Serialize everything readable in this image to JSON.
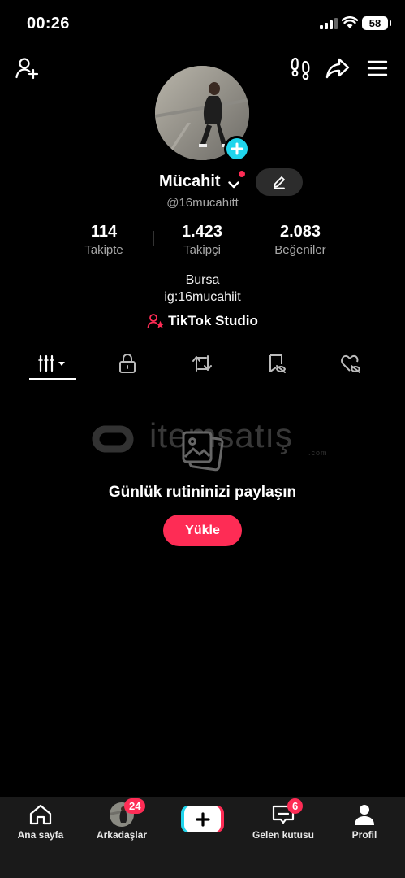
{
  "status_bar": {
    "time": "00:26",
    "battery": "58"
  },
  "profile": {
    "name": "Mücahit",
    "handle": "@16mucahitt",
    "stats": [
      {
        "value": "114",
        "label": "Takipte"
      },
      {
        "value": "1.423",
        "label": "Takipçi"
      },
      {
        "value": "2.083",
        "label": "Beğeniler"
      }
    ],
    "bio_line1": "Bursa",
    "bio_line2": "ig:16mucahiit",
    "studio_label": "TikTok Studio"
  },
  "watermark": {
    "brand": "itemsatış",
    "domain": ".com"
  },
  "empty_state": {
    "title": "Günlük rutininizi paylaşın",
    "button": "Yükle"
  },
  "bottom_nav": {
    "home": "Ana sayfa",
    "friends": "Arkadaşlar",
    "friends_badge": "24",
    "inbox": "Gelen kutusu",
    "inbox_badge": "6",
    "profile": "Profil"
  }
}
